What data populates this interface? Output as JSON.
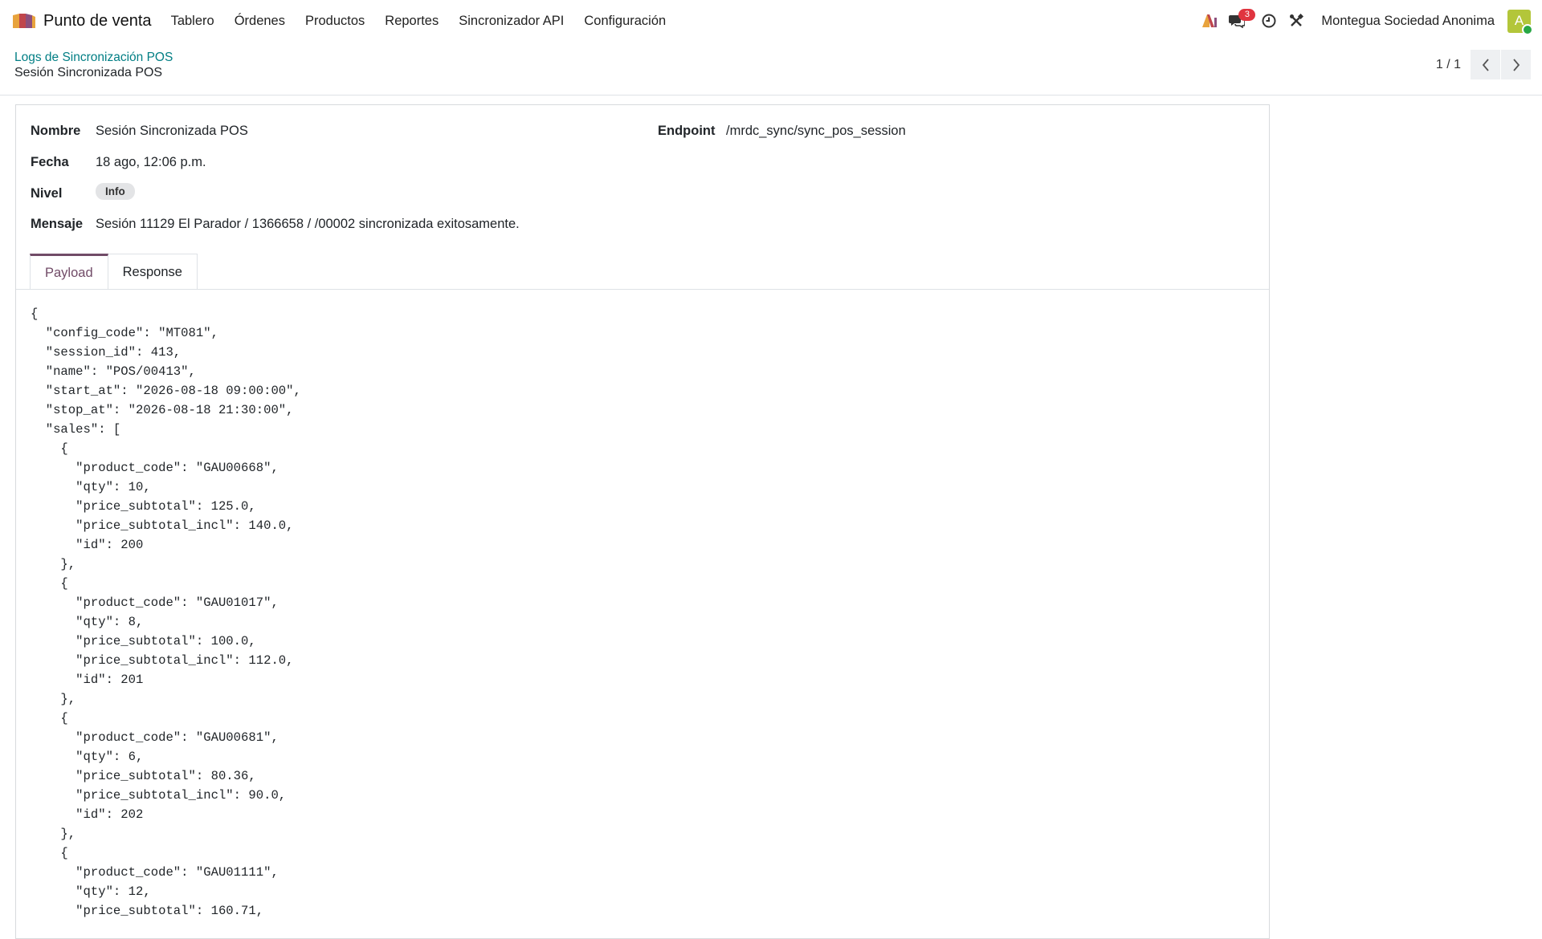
{
  "navbar": {
    "app_name": "Punto de venta",
    "menu": [
      "Tablero",
      "Órdenes",
      "Productos",
      "Reportes",
      "Sincronizador API",
      "Configuración"
    ],
    "chat_count": "3",
    "company": "Montegua Sociedad Anonima",
    "avatar_initial": "A"
  },
  "breadcrumb": {
    "parent": "Logs de Sincronización POS",
    "current": "Sesión Sincronizada POS"
  },
  "pager": {
    "value": "1 / 1"
  },
  "form": {
    "name_label": "Nombre",
    "name_value": "Sesión Sincronizada POS",
    "date_label": "Fecha",
    "date_value": "18 ago, 12:06 p.m.",
    "level_label": "Nivel",
    "level_value": "Info",
    "message_label": "Mensaje",
    "message_value": "Sesión 11129 El Parador / 1366658 / /00002 sincronizada exitosamente.",
    "endpoint_label": "Endpoint",
    "endpoint_value": "/mrdc_sync/sync_pos_session"
  },
  "tabs": {
    "payload": "Payload",
    "response": "Response"
  },
  "payload_text": "{\n  \"config_code\": \"MT081\",\n  \"session_id\": 413,\n  \"name\": \"POS/00413\",\n  \"start_at\": \"2026-08-18 09:00:00\",\n  \"stop_at\": \"2026-08-18 21:30:00\",\n  \"sales\": [\n    {\n      \"product_code\": \"GAU00668\",\n      \"qty\": 10,\n      \"price_subtotal\": 125.0,\n      \"price_subtotal_incl\": 140.0,\n      \"id\": 200\n    },\n    {\n      \"product_code\": \"GAU01017\",\n      \"qty\": 8,\n      \"price_subtotal\": 100.0,\n      \"price_subtotal_incl\": 112.0,\n      \"id\": 201\n    },\n    {\n      \"product_code\": \"GAU00681\",\n      \"qty\": 6,\n      \"price_subtotal\": 80.36,\n      \"price_subtotal_incl\": 90.0,\n      \"id\": 202\n    },\n    {\n      \"product_code\": \"GAU01111\",\n      \"qty\": 12,\n      \"price_subtotal\": 160.71,"
}
